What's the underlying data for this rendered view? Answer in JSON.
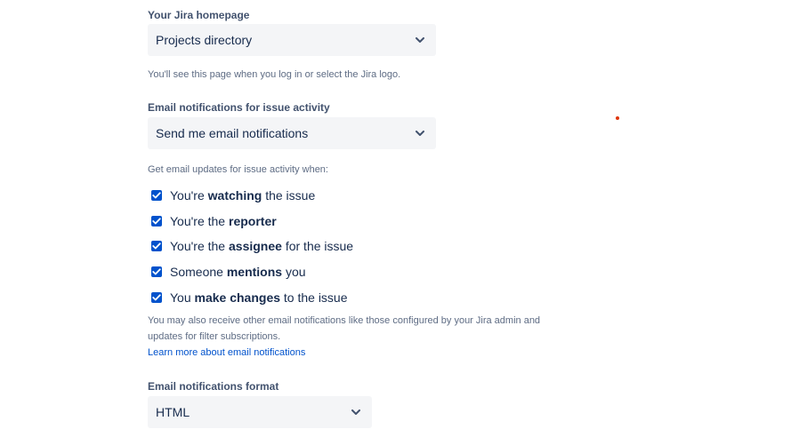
{
  "homepage": {
    "label": "Your Jira homepage",
    "selected": "Projects directory",
    "helper": "You'll see this page when you log in or select the Jira logo."
  },
  "email_notifications": {
    "label": "Email notifications for issue activity",
    "selected": "Send me email notifications",
    "helper": "Get email updates for issue activity when:"
  },
  "checkboxes": [
    {
      "pre": "You're ",
      "bold": "watching",
      "post": " the issue",
      "checked": true
    },
    {
      "pre": "You're the ",
      "bold": "reporter",
      "post": "",
      "checked": true
    },
    {
      "pre": "You're the ",
      "bold": "assignee",
      "post": " for the issue",
      "checked": true
    },
    {
      "pre": "Someone ",
      "bold": "mentions",
      "post": " you",
      "checked": true
    },
    {
      "pre": "You ",
      "bold": "make changes",
      "post": " to the issue",
      "checked": true
    }
  ],
  "info": {
    "line1": "You may also receive other email notifications like those configured by your Jira admin and",
    "line2": "updates for filter subscriptions.",
    "link": "Learn more about email notifications"
  },
  "format": {
    "label": "Email notifications format",
    "selected": "HTML"
  },
  "colors": {
    "accent": "#0052cc",
    "field_bg": "#f4f5f7",
    "text": "#172b4d",
    "muted": "#5e6c84"
  }
}
